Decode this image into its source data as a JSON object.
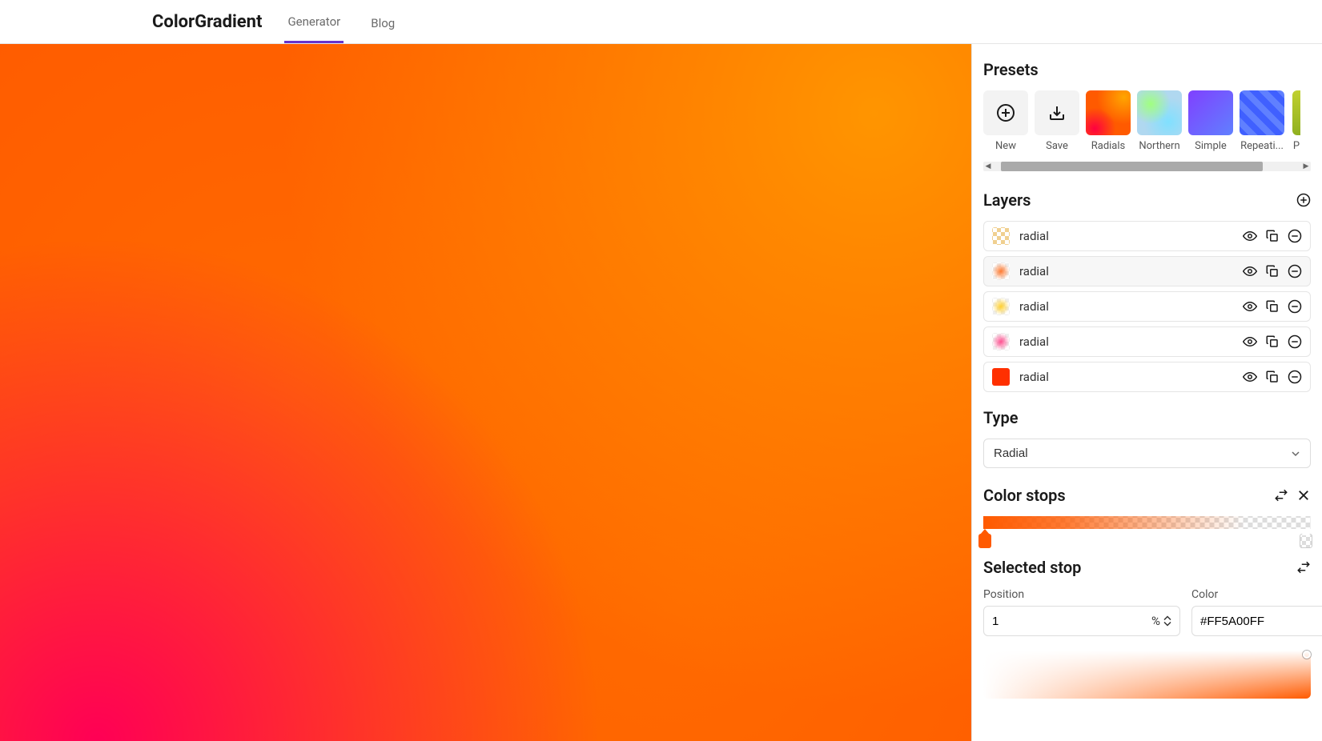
{
  "header": {
    "logo": "ColorGradient",
    "nav": [
      {
        "label": "Generator",
        "active": true
      },
      {
        "label": "Blog",
        "active": false
      }
    ]
  },
  "presets": {
    "title": "Presets",
    "items": [
      {
        "label": "New",
        "icon": "plus-circle"
      },
      {
        "label": "Save",
        "icon": "download"
      },
      {
        "label": "Radials",
        "swatch": "radials"
      },
      {
        "label": "Northern",
        "swatch": "northern"
      },
      {
        "label": "Simple",
        "swatch": "simple"
      },
      {
        "label": "Repeati...",
        "swatch": "repeating"
      },
      {
        "label": "P",
        "swatch": "partial"
      }
    ]
  },
  "layers": {
    "title": "Layers",
    "items": [
      {
        "name": "radial",
        "active": false
      },
      {
        "name": "radial",
        "active": true
      },
      {
        "name": "radial",
        "active": false
      },
      {
        "name": "radial",
        "active": false
      },
      {
        "name": "radial",
        "active": false
      }
    ]
  },
  "type": {
    "title": "Type",
    "selected": "Radial"
  },
  "color_stops": {
    "title": "Color stops",
    "stops": [
      {
        "position": 1,
        "color": "#FF5A00"
      },
      {
        "position": 100,
        "color": "rgba(255,90,0,0)"
      }
    ]
  },
  "selected_stop": {
    "title": "Selected stop",
    "position_label": "Position",
    "position_value": "1",
    "position_unit": "%",
    "color_label": "Color",
    "color_value": "#FF5A00FF"
  }
}
